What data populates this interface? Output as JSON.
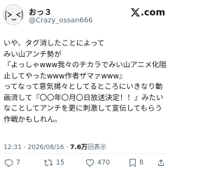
{
  "author": {
    "display_name": "おっ３",
    "handle": "@Crazy_ossan666",
    "avatar_icon": "kaomoji-avatar-icon"
  },
  "brand": {
    "logo_text": ".com",
    "logo_icon": "x-logo-icon"
  },
  "tweet": {
    "text": "いや、タグ消したことによって\nみい山アンチ勢が\n『よっしゃwww我々のチカラでみい山アニメ化阻止してやったwww作者ザマァwww』\nってなって意気揚々としてるところにいきなり動画流して『〇〇年〇月〇日放送決定！！』みたいなことしてアンチを更に刺激して宣伝してもらう作戦かもしれん。"
  },
  "meta": {
    "time": "12:31",
    "date": "2026/08/16",
    "separator": "·",
    "views_count": "7.6万",
    "views_label": "回表示"
  },
  "actions": {
    "reply_count": "7",
    "retweet_count": "15",
    "like_count": "470",
    "bookmark_count": "8"
  }
}
